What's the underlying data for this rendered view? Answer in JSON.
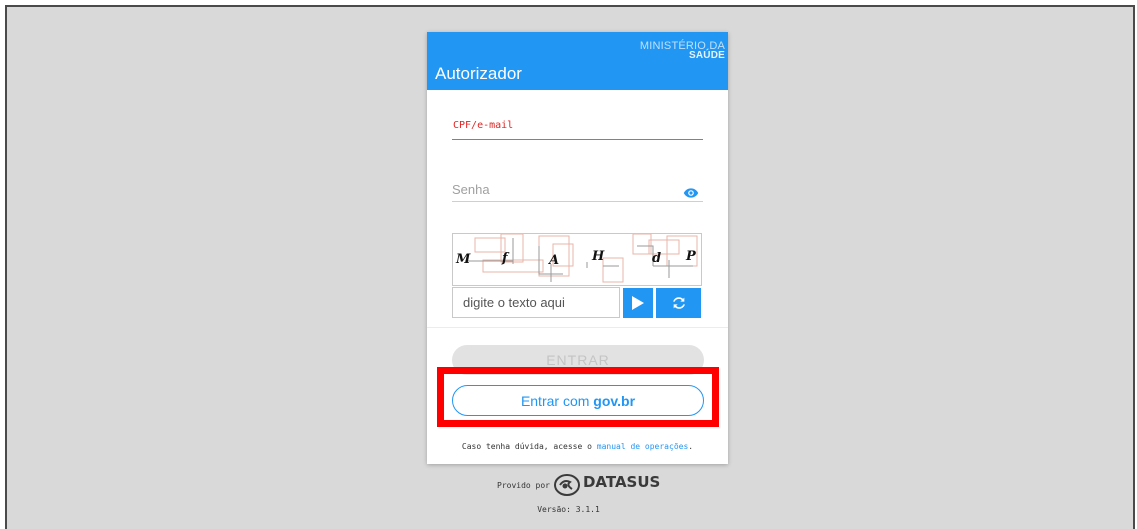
{
  "header": {
    "org_line1": "MINISTÉRIO DA",
    "org_line2": "SAÚDE",
    "title": "Autorizador"
  },
  "form": {
    "cpf_label": "CPF/e-mail",
    "senha_placeholder": "Senha",
    "captcha_chars": [
      "M",
      "f",
      "A",
      "H",
      "d",
      "P"
    ],
    "captcha_placeholder": "digite o texto aqui",
    "entrar_label": "ENTRAR",
    "govbr_prefix": "Entrar com ",
    "govbr_brand": "gov.br"
  },
  "help": {
    "prefix": "Caso tenha dúvida, acesse o ",
    "link": "manual de operações",
    "suffix": "."
  },
  "footer": {
    "provided_label": "Provido por",
    "logo_name": "DATASUS",
    "version": "Versão: 3.1.1"
  },
  "colors": {
    "accent": "#2196f3",
    "error": "#e02424",
    "highlight": "#ff0000"
  },
  "icons": [
    "eye-icon",
    "play-icon",
    "refresh-icon",
    "datasus-logo-icon"
  ]
}
